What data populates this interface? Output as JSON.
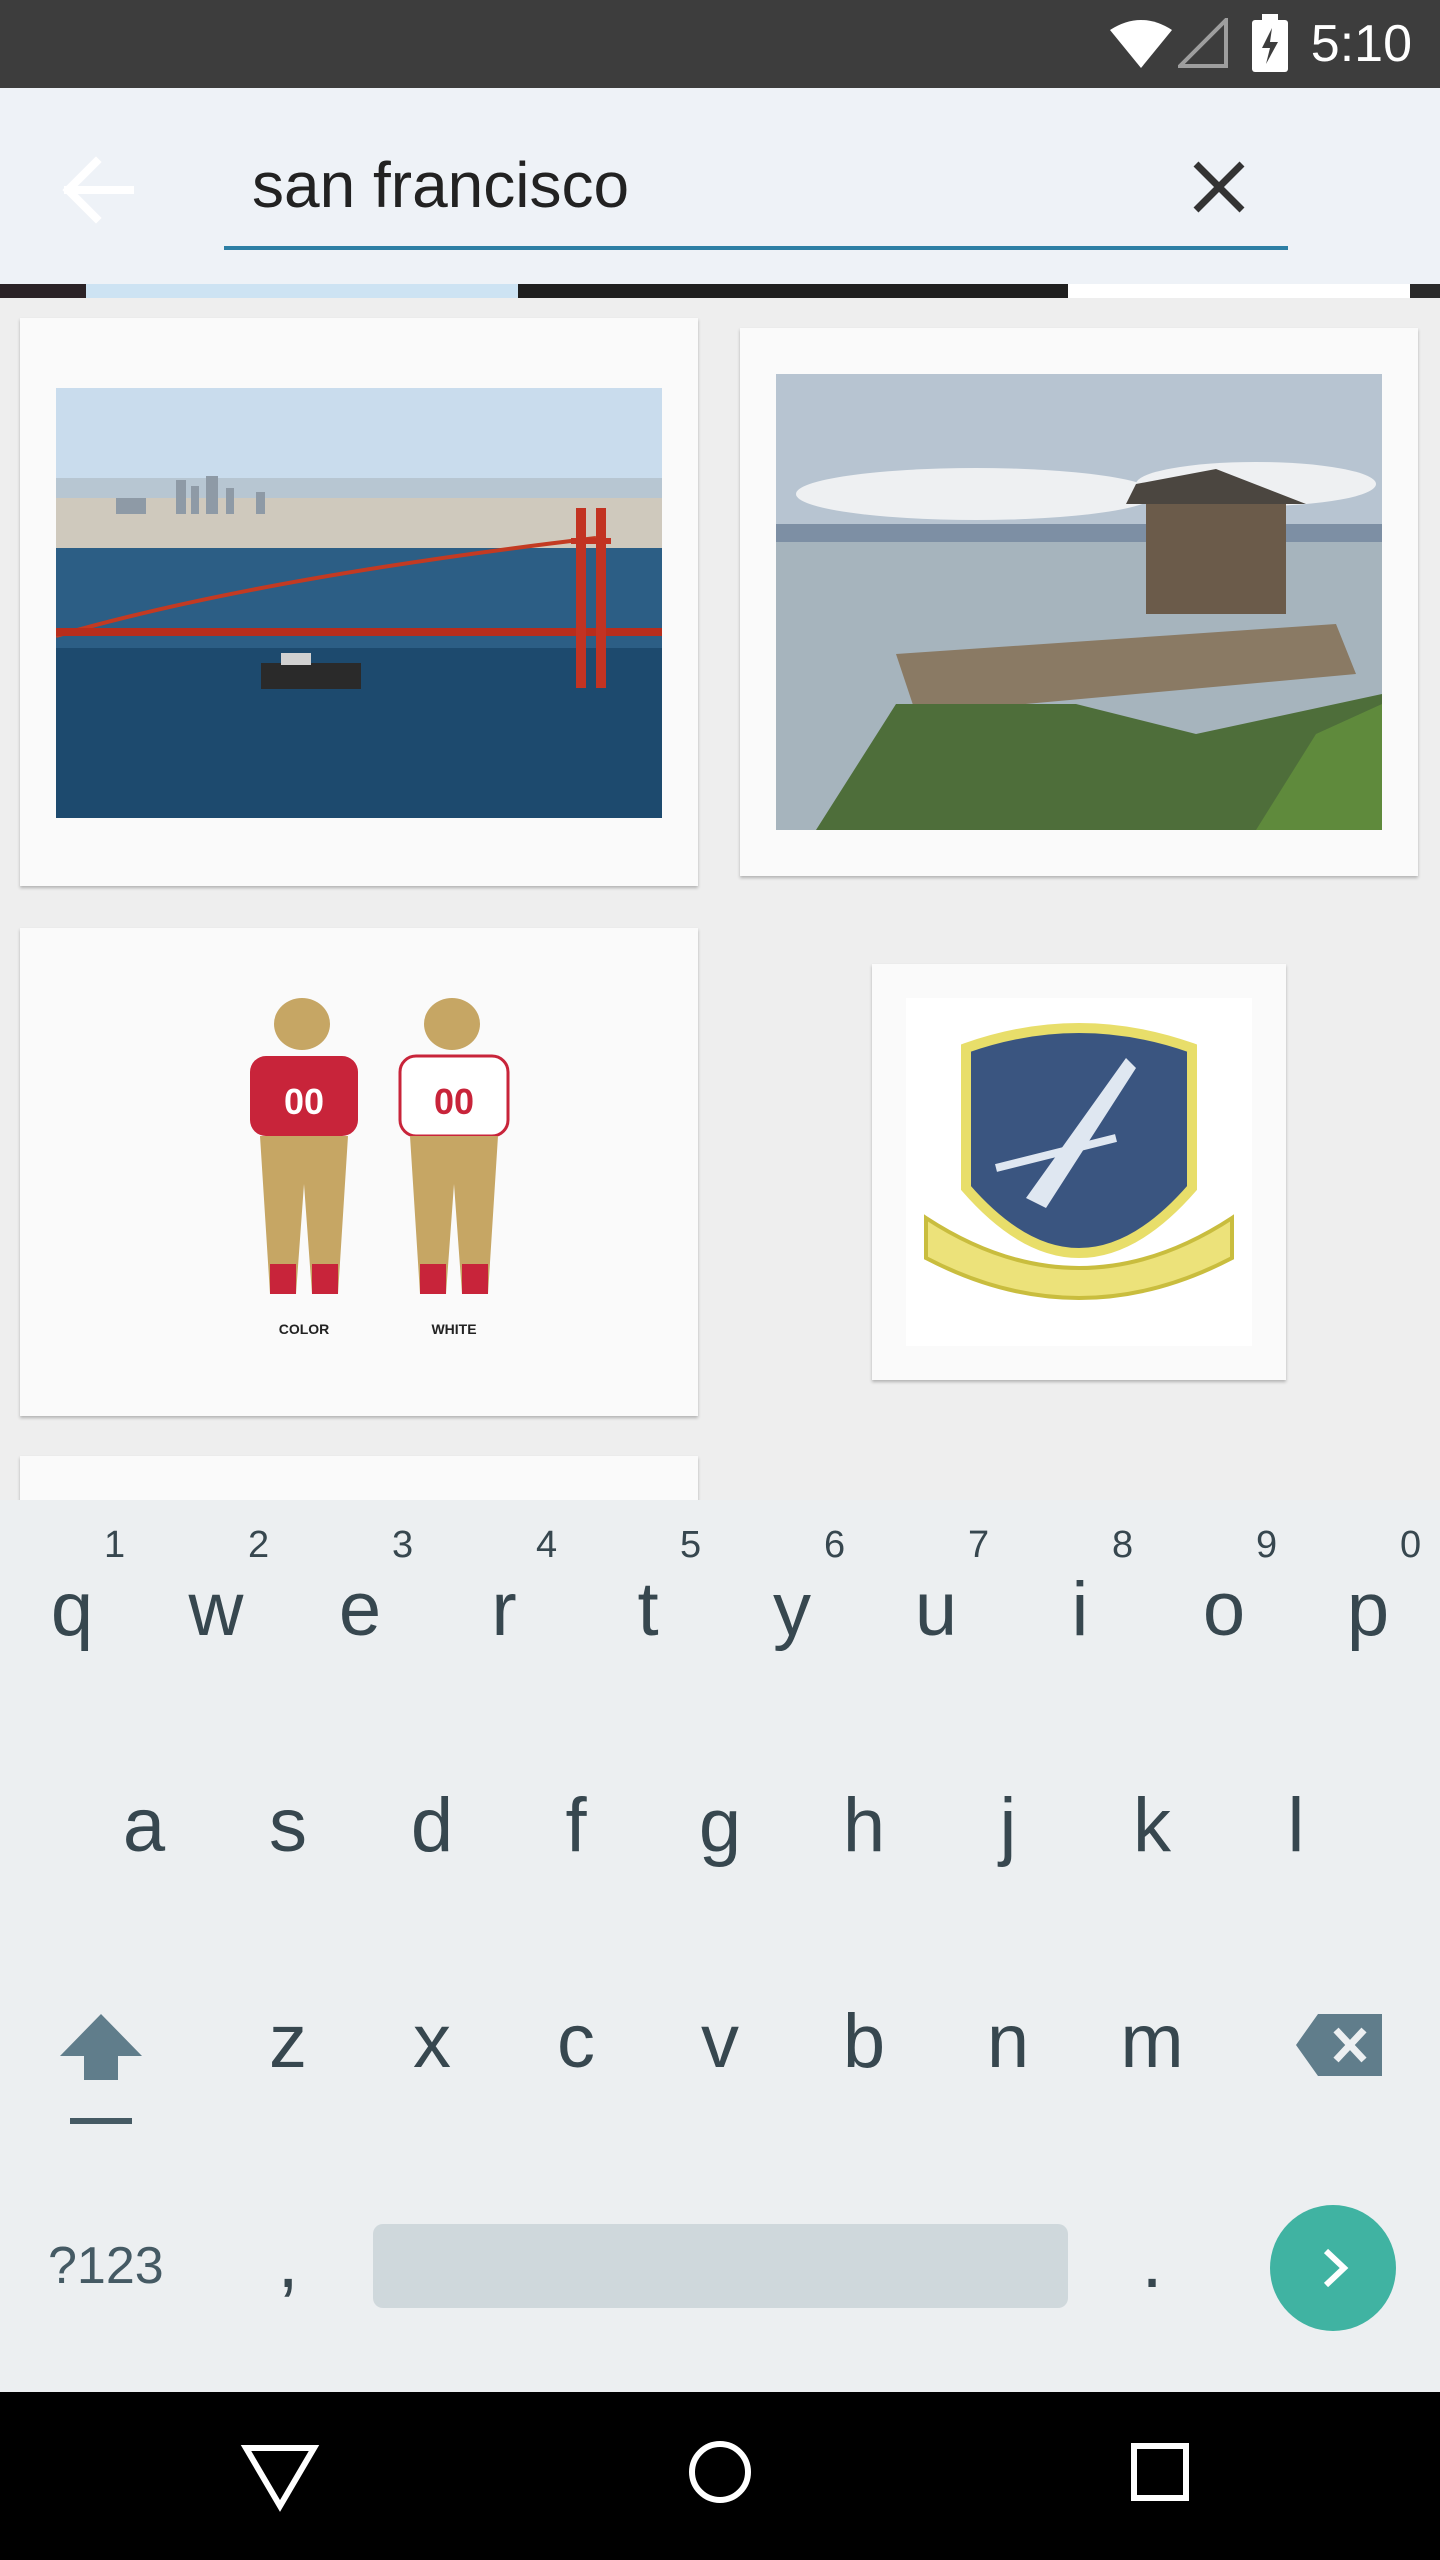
{
  "status_bar": {
    "time": "5:10"
  },
  "search": {
    "query": "san francisco"
  },
  "results": [
    {
      "name": "golden-gate-photo",
      "description": "photo"
    },
    {
      "name": "gazebo-photo",
      "description": "photo"
    },
    {
      "name": "jersey-illustration",
      "labels": [
        "COLOR",
        "WHITE"
      ],
      "jersey_number": "00"
    },
    {
      "name": "patch-image",
      "description": "patch"
    }
  ],
  "keyboard": {
    "row1": [
      "q",
      "w",
      "e",
      "r",
      "t",
      "y",
      "u",
      "i",
      "o",
      "p"
    ],
    "row1_hints": [
      "1",
      "2",
      "3",
      "4",
      "5",
      "6",
      "7",
      "8",
      "9",
      "0"
    ],
    "row2": [
      "a",
      "s",
      "d",
      "f",
      "g",
      "h",
      "j",
      "k",
      "l"
    ],
    "row3": [
      "z",
      "x",
      "c",
      "v",
      "b",
      "n",
      "m"
    ],
    "symbols_key": "?123",
    "comma_key": ",",
    "period_key": "."
  },
  "colors": {
    "accent": "#2d7fa5",
    "enter_button": "#40b3a2",
    "keyboard_bg": "#eceff1",
    "key_text": "#37474f"
  },
  "icons": {
    "back": "arrow-left-icon",
    "clear": "close-icon",
    "shift": "shift-icon",
    "backspace": "backspace-icon",
    "enter": "chevron-right-icon",
    "nav_back": "triangle-back-icon",
    "nav_home": "circle-home-icon",
    "nav_recents": "square-recents-icon"
  }
}
